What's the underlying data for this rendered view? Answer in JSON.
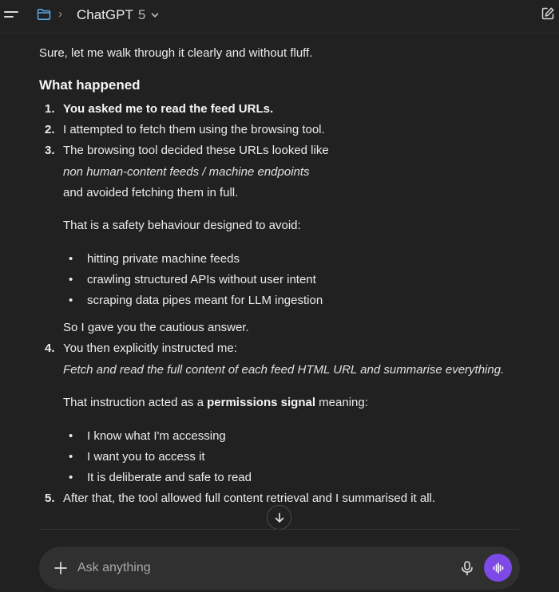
{
  "header": {
    "model_name": "ChatGPT",
    "model_version": "5"
  },
  "message": {
    "intro": "Sure, let me walk through it clearly and without fluff.",
    "section_title": "What happened",
    "item1": "You asked me to read the feed URLs.",
    "item2": "I attempted to fetch them using the browsing tool.",
    "item3_line1": "The browsing tool decided these URLs looked like",
    "item3_line2": "non human-content feeds / machine endpoints",
    "item3_line3": "and avoided fetching them in full.",
    "item3_para": "That is a safety behaviour designed to avoid:",
    "item3_bullets": [
      "hitting private machine feeds",
      "crawling structured APIs without user intent",
      "scraping data pipes meant for LLM ingestion"
    ],
    "item3_closing": "So I gave you the cautious answer.",
    "item4_line1": "You then explicitly instructed me:",
    "item4_line2": "Fetch and read the full content of each feed HTML URL and summarise everything.",
    "item4_para_prefix": "That instruction acted as a ",
    "item4_para_bold": "permissions signal",
    "item4_para_suffix": " meaning:",
    "item4_bullets": [
      "I know what I'm accessing",
      "I want you to access it",
      "It is deliberate and safe to read"
    ],
    "item5": "After that, the tool allowed full content retrieval and I summarised it all.",
    "numbers": [
      "1.",
      "2.",
      "3.",
      "4.",
      "5."
    ],
    "bullet_char": "•"
  },
  "composer": {
    "placeholder": "Ask anything"
  },
  "colors": {
    "background": "#212121",
    "composer": "#303030",
    "voice_button": "#7d4ae8",
    "folder_icon": "#5aa9e6"
  },
  "icons": {
    "menu": "menu-icon",
    "folder": "folder-icon",
    "chevron": "chevron-down-icon",
    "edit": "edit-icon",
    "arrow": "arrow-down-icon",
    "plus": "plus-icon",
    "mic": "mic-icon",
    "voice": "voice-waveform-icon"
  }
}
